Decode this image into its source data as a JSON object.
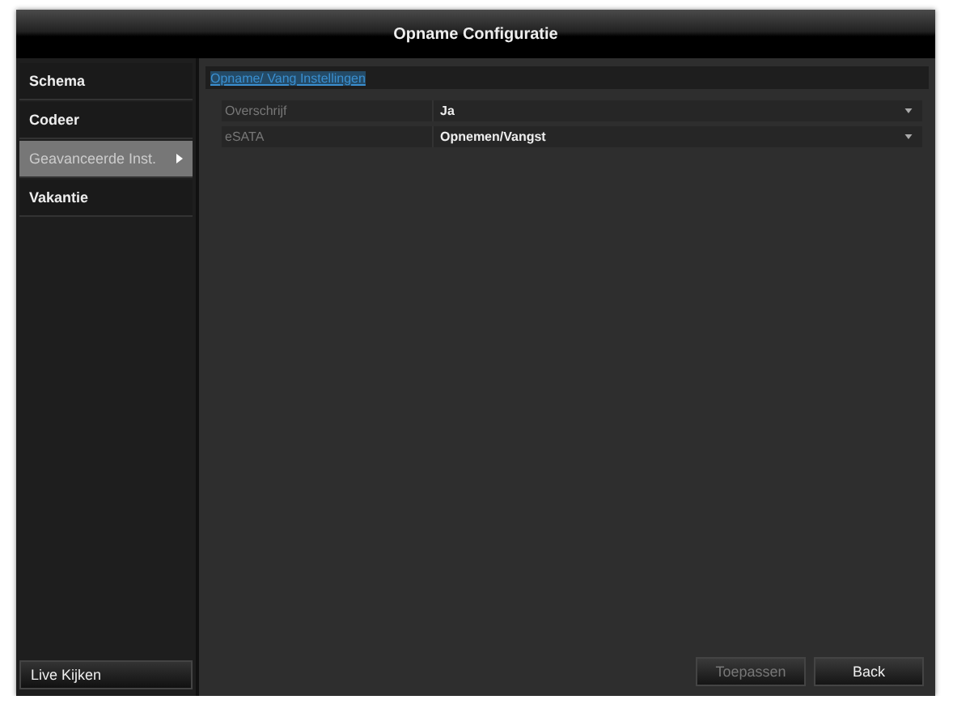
{
  "window": {
    "title": "Opname Configuratie"
  },
  "sidebar": {
    "items": [
      {
        "label": "Schema",
        "selected": false,
        "has_submenu": false
      },
      {
        "label": "Codeer",
        "selected": false,
        "has_submenu": false
      },
      {
        "label": "Geavanceerde Inst.",
        "selected": true,
        "has_submenu": true
      },
      {
        "label": "Vakantie",
        "selected": false,
        "has_submenu": false
      }
    ],
    "footer_button": "Live Kijken"
  },
  "tabs": [
    {
      "label": "Opname/ Vang Instellingen",
      "selected": true
    }
  ],
  "settings": [
    {
      "label": "Overschrijf",
      "value": "Ja"
    },
    {
      "label": "eSATA",
      "value": "Opnemen/Vangst"
    }
  ],
  "buttons": [
    {
      "label": "Toepassen",
      "disabled": true
    },
    {
      "label": "Back",
      "disabled": false
    }
  ]
}
